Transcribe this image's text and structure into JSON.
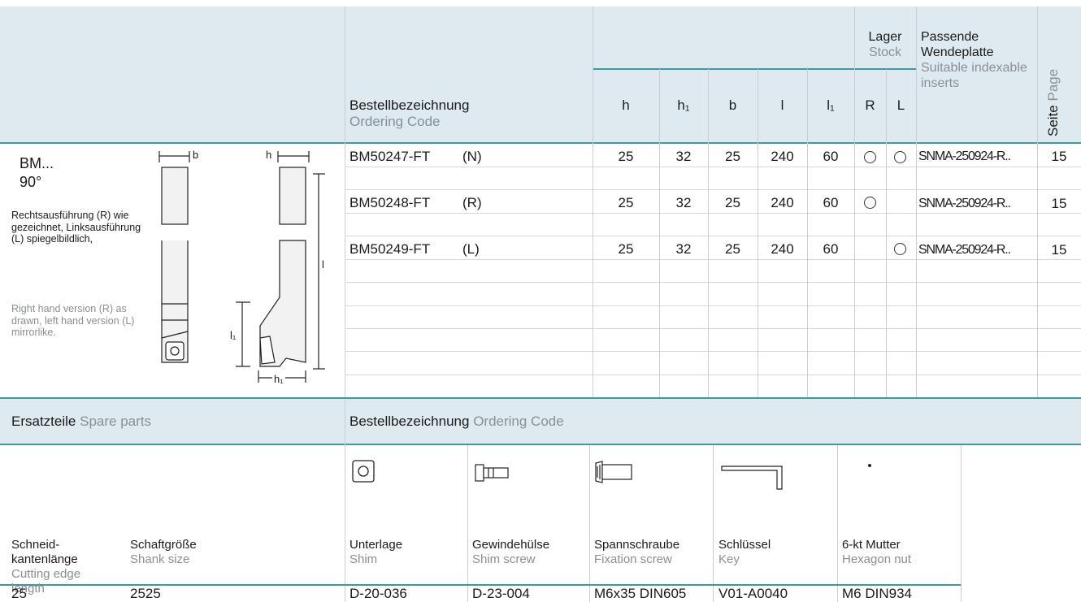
{
  "header": {
    "ordering_code_de": "Bestellbezeichnung",
    "ordering_code_en": "Ordering Code",
    "cols": [
      "h",
      "h₁",
      "b",
      "l",
      "l₁"
    ],
    "stock_de": "Lager",
    "stock_en": "Stock",
    "r": "R",
    "l": "L",
    "inserts_de": "Passende Wendeplatte",
    "inserts_en": "Suitable indexable inserts",
    "page_de": "Seite",
    "page_en": "Page"
  },
  "tool": {
    "name": "BM...",
    "angle": "90°",
    "note_de": "Rechtsausführung (R) wie gezeichnet, Linksausführung (L) spiegelbildlich,",
    "note_en": "Right hand version (R) as drawn, left hand version (L) mirrorlike.",
    "dim_b": "b",
    "dim_h": "h",
    "dim_l": "l",
    "dim_l1": "l₁",
    "dim_h1": "h₁"
  },
  "rows": [
    {
      "code": "BM50247-FT",
      "variant": "(N)",
      "h": "25",
      "h1": "32",
      "b": "25",
      "l": "240",
      "l1": "60",
      "r": true,
      "lft": true,
      "insert": "SNMA-250924-R..",
      "page": "15"
    },
    {
      "code": "BM50248-FT",
      "variant": "(R)",
      "h": "25",
      "h1": "32",
      "b": "25",
      "l": "240",
      "l1": "60",
      "r": true,
      "lft": false,
      "insert": "SNMA-250924-R..",
      "page": "15"
    },
    {
      "code": "BM50249-FT",
      "variant": "(L)",
      "h": "25",
      "h1": "32",
      "b": "25",
      "l": "240",
      "l1": "60",
      "r": false,
      "lft": true,
      "insert": "SNMA-250924-R..",
      "page": "15"
    }
  ],
  "spare": {
    "title_de": "Ersatzteile",
    "title_en": "Spare parts",
    "code_de": "Bestellbezeichnung",
    "code_en": "Ordering Code",
    "cutting_de": "Schneid- kantenlänge",
    "cutting_en": "Cutting edge length",
    "shank_de": "Schaftgröße",
    "shank_en": "Shank size",
    "parts": [
      {
        "de": "Unterlage",
        "en": "Shim",
        "value": "D-20-036",
        "icon": "shim-icon"
      },
      {
        "de": "Gewindehülse",
        "en": "Shim screw",
        "value": "D-23-004",
        "icon": "shim-screw-icon"
      },
      {
        "de": "Spannschraube",
        "en": "Fixation screw",
        "value": "M6x35 DIN605",
        "icon": "fixation-screw-icon"
      },
      {
        "de": "Schlüssel",
        "en": "Key",
        "value": "V01-A0040",
        "icon": "key-icon"
      },
      {
        "de": "6-kt Mutter",
        "en": "Hexagon nut",
        "value": "M6 DIN934",
        "icon": "hexagon-nut-icon"
      }
    ],
    "cutting_value": "25",
    "shank_value": "2525"
  }
}
